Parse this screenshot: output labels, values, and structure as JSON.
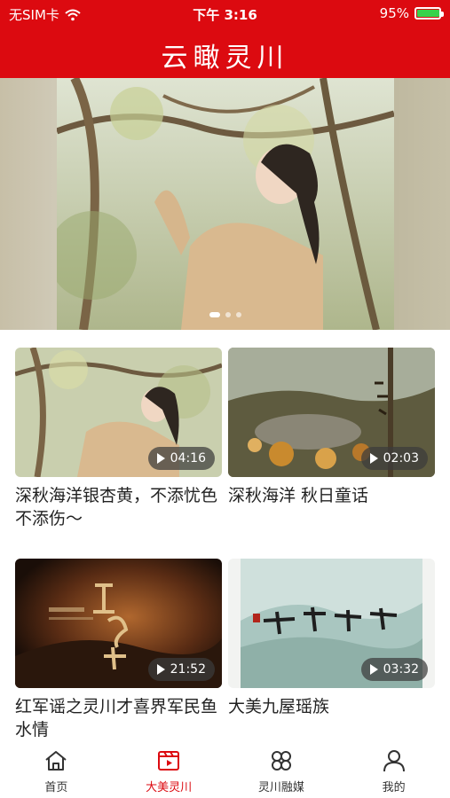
{
  "status": {
    "carrier": "无SIM卡",
    "time": "下午 3:16",
    "battery": "95%",
    "battery_level": 0.95
  },
  "header": {
    "title": "云瞰灵川"
  },
  "banner": {
    "slide_count": 3,
    "active_index": 0
  },
  "videos": [
    {
      "title": "深秋海洋银杏黄，不添忧色不添伤～",
      "duration": "04:16"
    },
    {
      "title": "深秋海洋 秋日童话",
      "duration": "02:03"
    },
    {
      "title": "红军谣之灵川才喜界军民鱼水情",
      "duration": "21:52"
    },
    {
      "title": "大美九屋瑶族",
      "duration": "03:32"
    }
  ],
  "tabs": [
    {
      "label": "首页",
      "icon": "home-icon",
      "active": false
    },
    {
      "label": "大美灵川",
      "icon": "video-icon",
      "active": true
    },
    {
      "label": "灵川融媒",
      "icon": "grid-icon",
      "active": false
    },
    {
      "label": "我的",
      "icon": "user-icon",
      "active": false
    }
  ],
  "colors": {
    "brand": "#dc0a10",
    "text": "#222222",
    "tab_inactive": "#333333"
  }
}
